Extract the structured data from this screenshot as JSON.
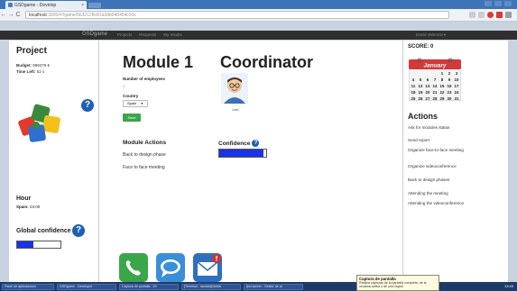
{
  "browser": {
    "tab_title": "GSDgame - Develop",
    "tab_close": "×",
    "back": "←",
    "forward": "→",
    "reload": "C",
    "url_domain": "localhost",
    "url_path": ":3000/#!/game/5632128c81a3db940454c93c"
  },
  "navbar": {
    "brand": "GSDgame",
    "items": [
      "Projects",
      "Requests",
      "My results"
    ],
    "user": "David Valencia ▾"
  },
  "project": {
    "title": "Project",
    "budget_label": "Budget:",
    "budget_value": "999279 €",
    "time_label": "Time Left:",
    "time_value": "52 s",
    "help_symbol": "?",
    "hour_title": "Hour",
    "hour_label": "Spain:",
    "hour_value": "04:00",
    "global_conf_title": "Global confidence",
    "global_conf_fraction": 0.38
  },
  "module": {
    "title": "Module 1",
    "employees_label": "Number of employees",
    "employees_value": "1",
    "country_label": "Country",
    "country_value": "Spain",
    "save_label": "Save",
    "actions_title": "Module Actions",
    "actions": [
      "Back to design phase",
      "Face to face meeting"
    ]
  },
  "coordinator": {
    "title": "Coordinator",
    "name": "Juan",
    "confidence_title": "Confidence",
    "confidence_fraction": 0.94
  },
  "sidebar": {
    "score": "SCORE: 0",
    "calendar_month": "January",
    "calendar_rows": [
      [
        "",
        "",
        "",
        "1",
        "2",
        "3"
      ],
      [
        "4",
        "5",
        "6",
        "7",
        "8",
        "9",
        "10"
      ],
      [
        "11",
        "12",
        "13",
        "14",
        "15",
        "16",
        "17"
      ],
      [
        "18",
        "19",
        "20",
        "21",
        "22",
        "23",
        "24"
      ],
      [
        "25",
        "26",
        "27",
        "28",
        "29",
        "30",
        "31"
      ]
    ],
    "actions_title": "Actions",
    "actions": [
      "Ask for modules status",
      "Send report",
      "Organize face-to-face meeting",
      "Organize videoconference",
      "Back to design phases",
      "Attending the meeting",
      "Attending the videoconference"
    ]
  },
  "taskbar": {
    "items": [
      "Panel de aplicaciones",
      "GSDgame - Developer",
      "Captura de pantalla - 29",
      "[Terminal - davidd@debia",
      "[ecl-server - Gestor de ar"
    ],
    "clock": "13:49"
  },
  "tooltip": {
    "title": "Captura de pantalla",
    "body": "Realiza capturas de la pantalla completa, de la ventana activa o de una región"
  },
  "colors": {
    "accent_blue": "#1e5fb3",
    "confidence_fill": "#1a33e8",
    "save_green": "#3aa64a",
    "calendar_red": "#d23a3a"
  }
}
